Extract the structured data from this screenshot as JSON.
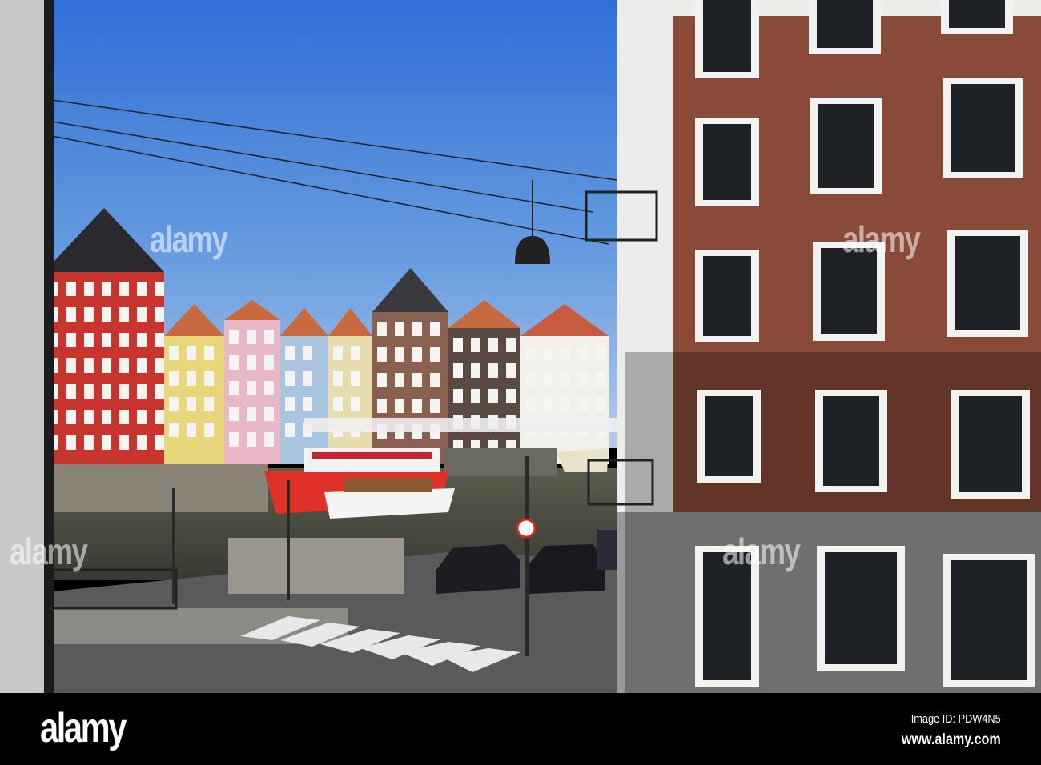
{
  "watermark": {
    "logo_text": "alamy",
    "image_id": "Image ID: PDW4N5",
    "website": "www.alamy.com"
  },
  "overlay_watermarks": [
    "alamy",
    "alamy",
    "alamy",
    "alamy"
  ],
  "colors": {
    "sky": "#3f7fd8",
    "brick": "#8a4a3a",
    "boat_red": "#e0302a",
    "water": "#4a4a40"
  }
}
